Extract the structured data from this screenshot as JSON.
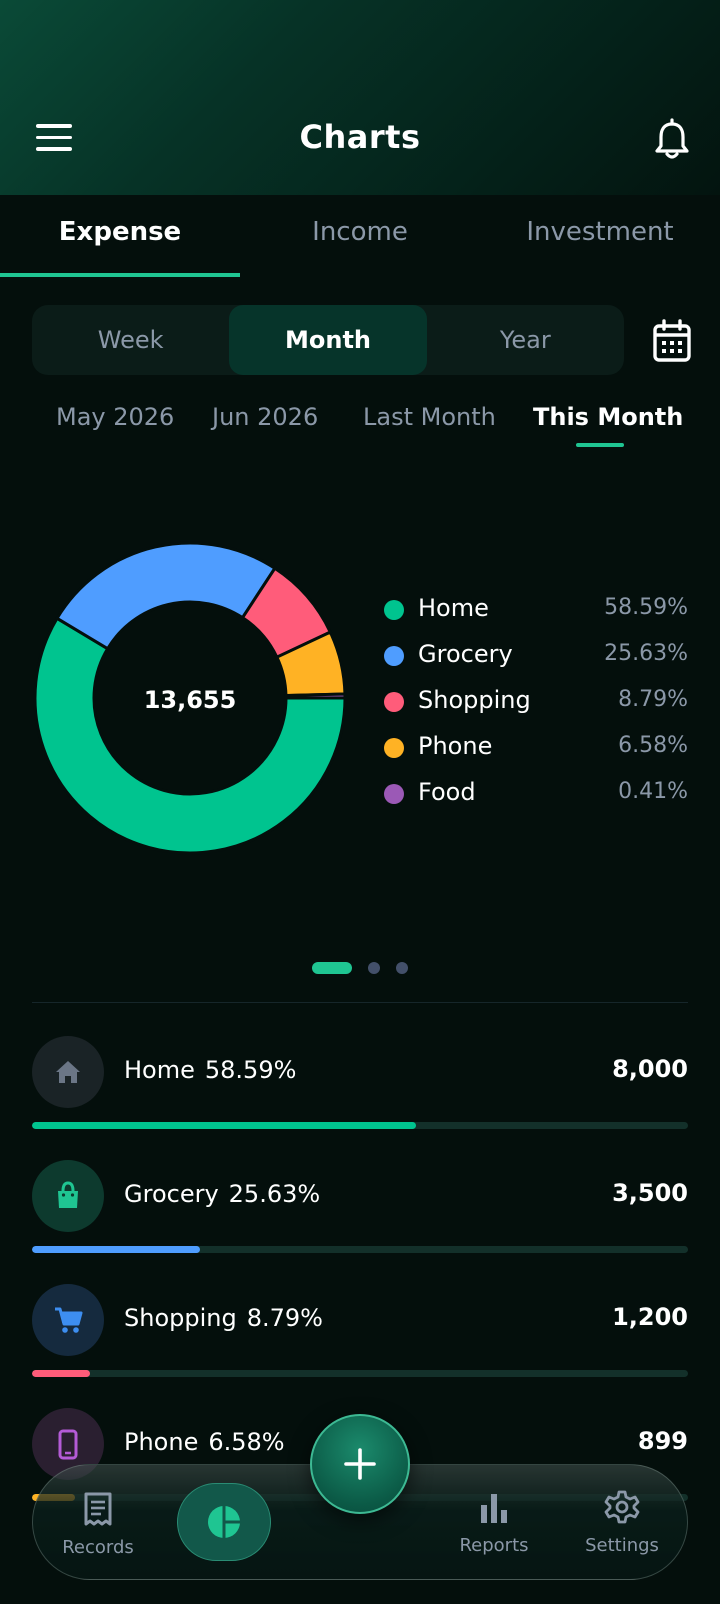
{
  "header": {
    "title": "Charts"
  },
  "type_tabs": [
    {
      "label": "Expense",
      "active": true
    },
    {
      "label": "Income",
      "active": false
    },
    {
      "label": "Investment",
      "active": false
    }
  ],
  "period": {
    "options": [
      "Week",
      "Month",
      "Year"
    ],
    "selected": "Month"
  },
  "months": [
    {
      "label": "May 2026",
      "active": false
    },
    {
      "label": "Jun 2026",
      "active": false
    },
    {
      "label": "Last Month",
      "active": false
    },
    {
      "label": "This Month",
      "active": true
    }
  ],
  "chart_data": {
    "type": "pie",
    "center_label": "13,655",
    "categories": [
      "Home",
      "Grocery",
      "Shopping",
      "Phone",
      "Food"
    ],
    "values": [
      58.59,
      25.63,
      8.79,
      6.58,
      0.41
    ],
    "value_labels": [
      "58.59%",
      "25.63%",
      "8.79%",
      "6.58%",
      "0.41%"
    ],
    "colors": [
      "#00c48f",
      "#4f9dff",
      "#ff5c7a",
      "#ffb224",
      "#9b59b6"
    ],
    "legend_position": "right"
  },
  "carousel": {
    "pages": 3,
    "current": 1
  },
  "categories": [
    {
      "name": "Home",
      "percent": "58.59%",
      "amount": "8,000",
      "share": 0.5859,
      "color": "#00c48f",
      "icon": "home-icon",
      "icon_bg": "#1a2326",
      "icon_color": "#6b7686"
    },
    {
      "name": "Grocery",
      "percent": "25.63%",
      "amount": "3,500",
      "share": 0.2563,
      "color": "#4f9dff",
      "icon": "shopping-bag-icon",
      "icon_bg": "#0d3a2e",
      "icon_color": "#1fc592"
    },
    {
      "name": "Shopping",
      "percent": "8.79%",
      "amount": "1,200",
      "share": 0.0879,
      "color": "#ff5c7a",
      "icon": "cart-icon",
      "icon_bg": "#152a3e",
      "icon_color": "#3d8ef0"
    },
    {
      "name": "Phone",
      "percent": "6.58%",
      "amount": "899",
      "share": 0.0658,
      "color": "#ffb224",
      "icon": "phone-icon",
      "icon_bg": "#2a1f30",
      "icon_color": "#b45bd6"
    }
  ],
  "nav": {
    "records": "Records",
    "reports": "Reports",
    "settings": "Settings"
  }
}
